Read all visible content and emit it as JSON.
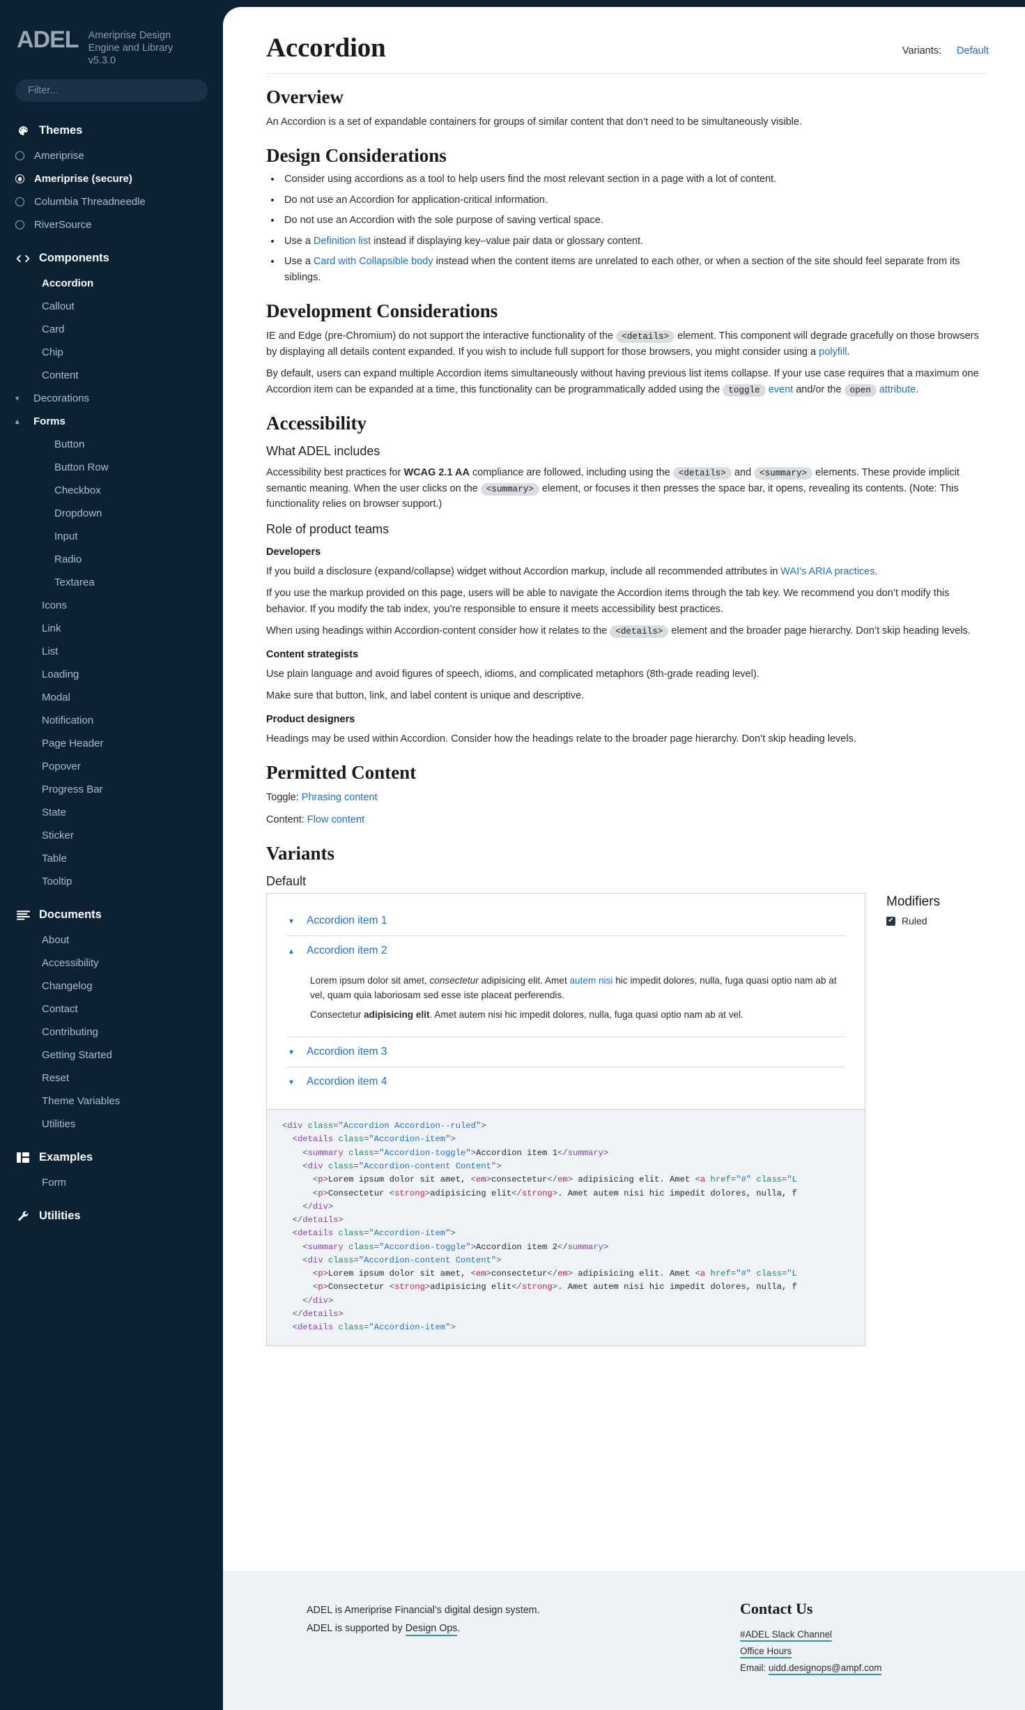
{
  "sidebar": {
    "logo": "ADEL",
    "tagline": "Ameriprise Design Engine and Library v5.3.0",
    "filter_placeholder": "Filter...",
    "themes": {
      "label": "Themes",
      "options": [
        {
          "label": "Ameriprise",
          "selected": false
        },
        {
          "label": "Ameriprise (secure)",
          "selected": true
        },
        {
          "label": "Columbia Threadneedle",
          "selected": false
        },
        {
          "label": "RiverSource",
          "selected": false
        }
      ]
    },
    "components": {
      "label": "Components",
      "items": [
        {
          "label": "Accordion",
          "active": true,
          "type": "item"
        },
        {
          "label": "Callout",
          "active": false,
          "type": "item"
        },
        {
          "label": "Card",
          "active": false,
          "type": "item"
        },
        {
          "label": "Chip",
          "active": false,
          "type": "item"
        },
        {
          "label": "Content",
          "active": false,
          "type": "item"
        },
        {
          "label": "Decorations",
          "active": false,
          "type": "group",
          "open": false
        },
        {
          "label": "Forms",
          "active": false,
          "type": "group",
          "open": true
        },
        {
          "label": "Button",
          "active": false,
          "type": "sub"
        },
        {
          "label": "Button Row",
          "active": false,
          "type": "sub"
        },
        {
          "label": "Checkbox",
          "active": false,
          "type": "sub"
        },
        {
          "label": "Dropdown",
          "active": false,
          "type": "sub"
        },
        {
          "label": "Input",
          "active": false,
          "type": "sub"
        },
        {
          "label": "Radio",
          "active": false,
          "type": "sub"
        },
        {
          "label": "Textarea",
          "active": false,
          "type": "sub"
        },
        {
          "label": "Icons",
          "active": false,
          "type": "item"
        },
        {
          "label": "Link",
          "active": false,
          "type": "item"
        },
        {
          "label": "List",
          "active": false,
          "type": "item"
        },
        {
          "label": "Loading",
          "active": false,
          "type": "item"
        },
        {
          "label": "Modal",
          "active": false,
          "type": "item"
        },
        {
          "label": "Notification",
          "active": false,
          "type": "item"
        },
        {
          "label": "Page Header",
          "active": false,
          "type": "item"
        },
        {
          "label": "Popover",
          "active": false,
          "type": "item"
        },
        {
          "label": "Progress Bar",
          "active": false,
          "type": "item"
        },
        {
          "label": "State",
          "active": false,
          "type": "item"
        },
        {
          "label": "Sticker",
          "active": false,
          "type": "item"
        },
        {
          "label": "Table",
          "active": false,
          "type": "item"
        },
        {
          "label": "Tooltip",
          "active": false,
          "type": "item"
        }
      ]
    },
    "documents": {
      "label": "Documents",
      "items": [
        "About",
        "Accessibility",
        "Changelog",
        "Contact",
        "Contributing",
        "Getting Started",
        "Reset",
        "Theme Variables",
        "Utilities"
      ]
    },
    "examples": {
      "label": "Examples",
      "items": [
        "Form"
      ]
    },
    "utilities": {
      "label": "Utilities"
    }
  },
  "header": {
    "title": "Accordion",
    "variants_label": "Variants:",
    "variant_default": "Default"
  },
  "overview": {
    "heading": "Overview",
    "text": "An Accordion is a set of expandable containers for groups of similar content that don’t need to be simultaneously visible."
  },
  "design": {
    "heading": "Design Considerations",
    "bullets": [
      {
        "pre": "Consider using accordions as a tool to help users find the most relevant section in a page with a lot of content.",
        "link": "",
        "post": ""
      },
      {
        "pre": "Do not use an Accordion for application-critical information.",
        "link": "",
        "post": ""
      },
      {
        "pre": "Do not use an Accordion with the sole purpose of saving vertical space.",
        "link": "",
        "post": ""
      },
      {
        "pre": "Use a ",
        "link": "Definition list",
        "post": " instead if displaying key–value pair data or glossary content."
      },
      {
        "pre": "Use a ",
        "link": "Card with Collapsible body",
        "post": " instead when the content items are unrelated to each other, or when a section of the site should feel separate from its siblings."
      }
    ]
  },
  "development": {
    "heading": "Development Considerations",
    "p1_a": "IE and Edge (pre-Chromium) do not support the interactive functionality of the ",
    "p1_code": "<details>",
    "p1_b": " element. This component will degrade gracefully on those browsers by displaying all details content expanded. If you wish to include full support for those browsers, you might consider using a ",
    "p1_link": "polyfill",
    "p1_c": ".",
    "p2_a": "By default, users can expand multiple Accordion items simultaneously without having previous list items collapse. If your use case requires that a maximum one Accordion item can be expanded at a time, this functionality can be programmatically added using the ",
    "p2_code1": "toggle",
    "p2_link1": "event",
    "p2_mid": " and/or the ",
    "p2_code2": "open",
    "p2_link2": "attribute",
    "p2_end": "."
  },
  "accessibility": {
    "heading": "Accessibility",
    "sub1": "What ADEL includes",
    "a1": "Accessibility best practices for ",
    "a1_strong": "WCAG 2.1 AA",
    "a2": " compliance are followed, including using the ",
    "code_details": "<details>",
    "a3": " and ",
    "code_summary": "<summary>",
    "a4": " elements. These provide implicit semantic meaning. When the user clicks on the ",
    "a5": " element, or focuses it then presses the space bar, it opens, revealing its contents. (Note: This functionality relies on browser support.)",
    "sub2": "Role of product teams",
    "dev_label": "Developers",
    "dev_p1_a": "If you build a disclosure (expand/collapse) widget without Accordion markup, include all recommended attributes in ",
    "dev_p1_link": "WAI's ARIA practices",
    "dev_p1_b": ".",
    "dev_p2": "If you use the markup provided on this page, users will be able to navigate the Accordion items through the tab key. We recommend you don’t modify this behavior. If you modify the tab index, you’re responsible to ensure it meets accessibility best practices.",
    "dev_p3_a": "When using headings within Accordion-content consider how it relates to the ",
    "dev_p3_b": " element and the broader page hierarchy. Don’t skip heading levels.",
    "cs_label": "Content strategists",
    "cs_p1": "Use plain language and avoid figures of speech, idioms, and complicated metaphors (8th-grade reading level).",
    "cs_p2": "Make sure that button, link, and label content is unique and descriptive.",
    "pd_label": "Product designers",
    "pd_p1": "Headings may be used within Accordion. Consider how the headings relate to the broader page hierarchy. Don’t skip heading levels."
  },
  "permitted": {
    "heading": "Permitted Content",
    "toggle_label": "Toggle: ",
    "toggle_link": "Phrasing content",
    "content_label": "Content: ",
    "content_link": "Flow content"
  },
  "variants": {
    "heading": "Variants",
    "subheading": "Default",
    "items": [
      {
        "label": "Accordion item 1",
        "open": false
      },
      {
        "label": "Accordion item 2",
        "open": true
      },
      {
        "label": "Accordion item 3",
        "open": false
      },
      {
        "label": "Accordion item 4",
        "open": false
      }
    ],
    "open_content": {
      "p1_a": "Lorem ipsum dolor sit amet, ",
      "p1_em": "consectetur",
      "p1_b": " adipisicing elit. Amet ",
      "p1_link": "autem nisi",
      "p1_c": " hic impedit dolores, nulla, fuga quasi optio nam ab at vel, quam quia laboriosam sed esse iste placeat perferendis.",
      "p2_a": "Consectetur ",
      "p2_strong": "adipisicing elit",
      "p2_b": ". Amet autem nisi hic impedit dolores, nulla, fuga quasi optio nam ab at vel."
    },
    "modifiers_heading": "Modifiers",
    "modifier_ruled": "Ruled",
    "modifier_ruled_checked": true
  },
  "code": {
    "lines": [
      "<div class=\"Accordion Accordion--ruled\">",
      "  <details class=\"Accordion-item\">",
      "    <summary class=\"Accordion-toggle\">Accordion item 1</summary>",
      "    <div class=\"Accordion-content Content\">",
      "      <p>Lorem ipsum dolor sit amet, <em>consectetur</em> adipisicing elit. Amet <a href=\"#\" class=\"L",
      "      <p>Consectetur <strong>adipisicing elit</strong>. Amet autem nisi hic impedit dolores, nulla, f",
      "    </div>",
      "  </details>",
      "  <details class=\"Accordion-item\">",
      "    <summary class=\"Accordion-toggle\">Accordion item 2</summary>",
      "    <div class=\"Accordion-content Content\">",
      "      <p>Lorem ipsum dolor sit amet, <em>consectetur</em> adipisicing elit. Amet <a href=\"#\" class=\"L",
      "      <p>Consectetur <strong>adipisicing elit</strong>. Amet autem nisi hic impedit dolores, nulla, f",
      "    </div>",
      "  </details>",
      "  <details class=\"Accordion-item\">"
    ]
  },
  "footer": {
    "line1": "ADEL is Ameriprise Financial’s digital design system.",
    "line2_a": "ADEL is supported by ",
    "line2_link": "Design Ops",
    "line2_b": ".",
    "contact_heading": "Contact Us",
    "slack": "#ADEL Slack Channel",
    "office_hours": "Office Hours",
    "email_label": "Email: ",
    "email": "uidd.designops@ampf.com"
  },
  "colors": {
    "sidebar_bg": "#0d2135",
    "link_blue": "#1f6fc4",
    "teal_underline": "#2f9e92",
    "code_bg": "#eff3f8"
  }
}
